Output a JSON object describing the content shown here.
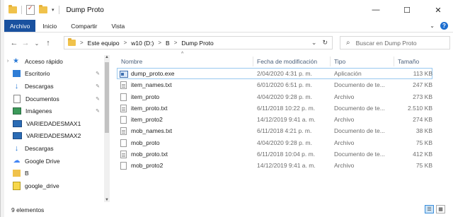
{
  "window": {
    "title": "Dump Proto",
    "minimize_glyph": "—",
    "maximize_glyph": "☐",
    "close_glyph": "✕"
  },
  "ribbon": {
    "tabs": [
      "Archivo",
      "Inicio",
      "Compartir",
      "Vista"
    ],
    "file_tab_color": "#19519f",
    "help_glyph": "?",
    "collapse_glyph": "⌄"
  },
  "address": {
    "crumbs": [
      "Este equipo",
      "w10 (D:)",
      "B",
      "Dump Proto"
    ],
    "separator": ">",
    "dropdown_glyph": "⌄",
    "refresh_glyph": "↻"
  },
  "search": {
    "placeholder": "Buscar en Dump Proto",
    "icon": "search-icon"
  },
  "nav": {
    "back": "←",
    "forward": "→",
    "recent": "⌄",
    "up": "↑"
  },
  "sidebar": {
    "items": [
      {
        "label": "Acceso rápido",
        "icon": "star-icon",
        "pinned": false
      },
      {
        "label": "Escritorio",
        "icon": "desktop-icon",
        "pinned": true
      },
      {
        "label": "Descargas",
        "icon": "download-icon",
        "pinned": true
      },
      {
        "label": "Documentos",
        "icon": "document-icon",
        "pinned": true
      },
      {
        "label": "Imágenes",
        "icon": "pictures-icon",
        "pinned": true
      },
      {
        "label": "VARIEDADESMAX1",
        "icon": "monitor-icon",
        "pinned": false
      },
      {
        "label": "VARIEDADESMAX2",
        "icon": "monitor-icon",
        "pinned": false
      },
      {
        "label": "Descargas",
        "icon": "download-icon",
        "pinned": false
      },
      {
        "label": "Google Drive",
        "icon": "cloud-icon",
        "pinned": false
      },
      {
        "label": "B",
        "icon": "folder-icon",
        "pinned": false
      },
      {
        "label": "google_drive",
        "icon": "gdrive-folder-icon",
        "pinned": false
      }
    ],
    "pin_glyph": "📌"
  },
  "columns": {
    "name": "Nombre",
    "date": "Fecha de modificación",
    "type": "Tipo",
    "size": "Tamaño",
    "sort_glyph": "^"
  },
  "files": [
    {
      "name": "dump_proto.exe",
      "date": "2/04/2020 4:31 p. m.",
      "type": "Aplicación",
      "size": "113 KB",
      "kind": "exe"
    },
    {
      "name": "item_names.txt",
      "date": "6/01/2020 6:51 p. m.",
      "type": "Documento de te...",
      "size": "247 KB",
      "kind": "txt"
    },
    {
      "name": "item_proto",
      "date": "4/04/2020 9:28 p. m.",
      "type": "Archivo",
      "size": "273 KB",
      "kind": "file"
    },
    {
      "name": "item_proto.txt",
      "date": "6/11/2018 10:22 p. m.",
      "type": "Documento de te...",
      "size": "2.510 KB",
      "kind": "txt"
    },
    {
      "name": "item_proto2",
      "date": "14/12/2019 9:41 a. m.",
      "type": "Archivo",
      "size": "274 KB",
      "kind": "file"
    },
    {
      "name": "mob_names.txt",
      "date": "6/11/2018 4:21 p. m.",
      "type": "Documento de te...",
      "size": "38 KB",
      "kind": "txt"
    },
    {
      "name": "mob_proto",
      "date": "4/04/2020 9:28 p. m.",
      "type": "Archivo",
      "size": "75 KB",
      "kind": "file"
    },
    {
      "name": "mob_proto.txt",
      "date": "6/11/2018 10:04 p. m.",
      "type": "Documento de te...",
      "size": "412 KB",
      "kind": "txt"
    },
    {
      "name": "mob_proto2",
      "date": "14/12/2019 9:41 a. m.",
      "type": "Archivo",
      "size": "75 KB",
      "kind": "file"
    }
  ],
  "status": {
    "count": "9 elementos"
  }
}
